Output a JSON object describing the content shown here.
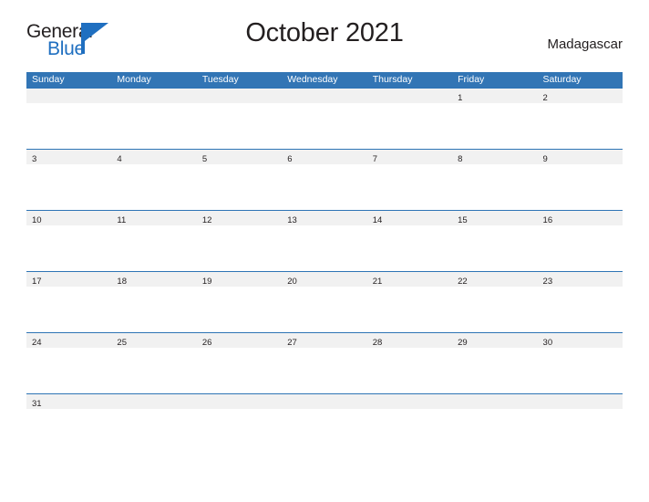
{
  "brand": {
    "word_one": "General",
    "word_two": "Blue",
    "mark": "triangle-logo",
    "accent_color": "#1f6fc0"
  },
  "header": {
    "title": "October 2021",
    "country": "Madagascar"
  },
  "colors": {
    "header_blue": "#3275b5",
    "row_rule_blue": "#2e74b5",
    "day_band_gray": "#f1f1f1",
    "text": "#231f20",
    "page_background": "#ffffff"
  },
  "calendar": {
    "month": "October",
    "year": "2021",
    "weekdays": [
      "Sunday",
      "Monday",
      "Tuesday",
      "Wednesday",
      "Thursday",
      "Friday",
      "Saturday"
    ],
    "weeks": [
      [
        "",
        "",
        "",
        "",
        "",
        "1",
        "2"
      ],
      [
        "3",
        "4",
        "5",
        "6",
        "7",
        "8",
        "9"
      ],
      [
        "10",
        "11",
        "12",
        "13",
        "14",
        "15",
        "16"
      ],
      [
        "17",
        "18",
        "19",
        "20",
        "21",
        "22",
        "23"
      ],
      [
        "24",
        "25",
        "26",
        "27",
        "28",
        "29",
        "30"
      ],
      [
        "31",
        "",
        "",
        "",
        "",
        "",
        ""
      ]
    ]
  }
}
